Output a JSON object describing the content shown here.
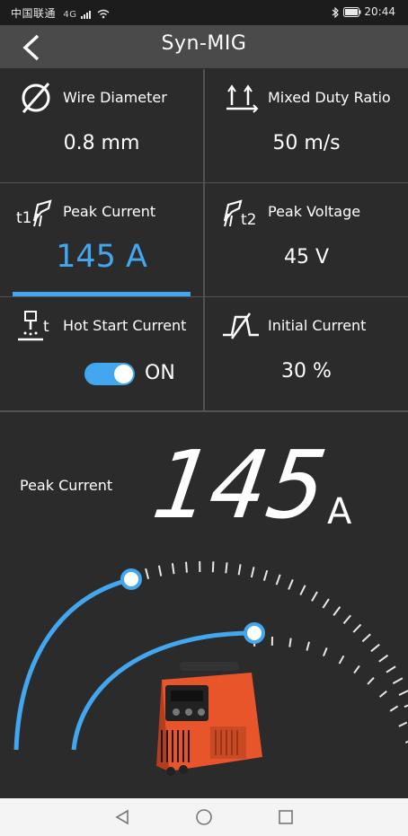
{
  "status_bar": {
    "carrier": "中国联通",
    "network": "4G",
    "time": "20:44"
  },
  "header": {
    "title": "Syn-MIG"
  },
  "settings": [
    {
      "label": "Wire Diameter",
      "value": "0.8 mm",
      "icon": "diameter-icon"
    },
    {
      "label": "Mixed Duty Ratio",
      "value": "50 m/s",
      "icon": "duty-ratio-icon"
    },
    {
      "label": "Peak Current",
      "value": "145 A",
      "icon": "peak-current-icon",
      "selected": true
    },
    {
      "label": "Peak Voltage",
      "value": "45 V",
      "icon": "peak-voltage-icon"
    },
    {
      "label": "Hot Start Current",
      "value": "ON",
      "icon": "hot-start-icon",
      "toggle": true
    },
    {
      "label": "Initial Current",
      "value": "30 %",
      "icon": "initial-current-icon"
    }
  ],
  "display": {
    "label": "Peak Current",
    "value": "145",
    "unit": "A"
  },
  "colors": {
    "accent": "#42a7ef",
    "background": "#2b2b2b",
    "header": "#4a4a4a",
    "welder_body": "#e8552b"
  },
  "nav": {
    "back_icon": "back-icon",
    "home_icon": "home-icon",
    "recents_icon": "recents-icon"
  }
}
